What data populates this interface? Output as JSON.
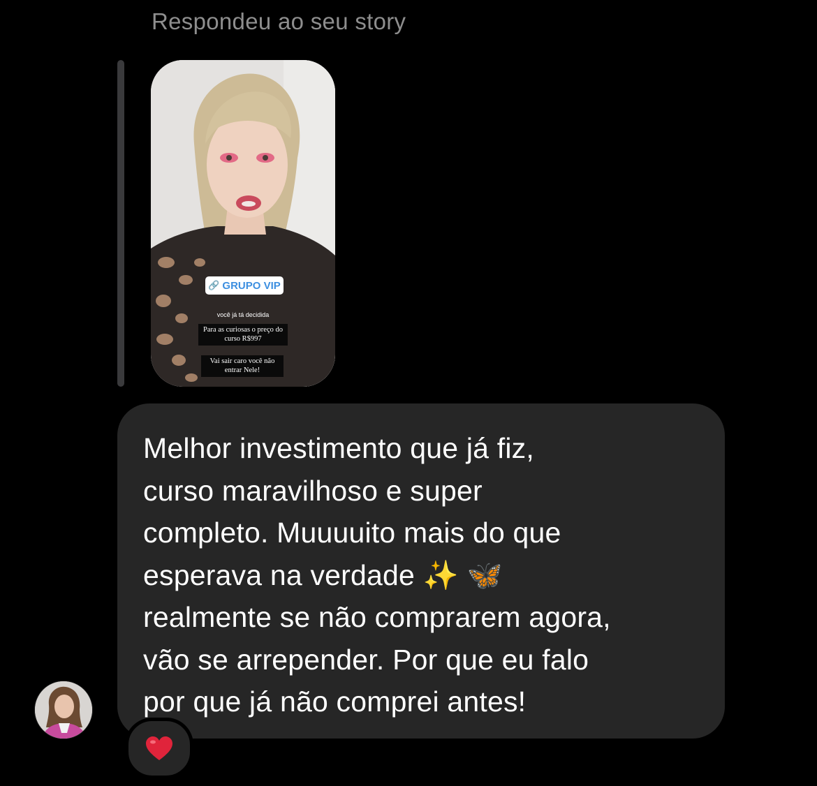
{
  "reply_header": "Respondeu ao seu story",
  "story": {
    "link_sticker": "GRUPO VIP",
    "link_icon": "link-icon",
    "caption_small": "você já tá decidida",
    "caption_box_1": "Para as curiosas o preço do curso R$997",
    "caption_box_2": "Vai sair caro você não entrar Nele!"
  },
  "message": {
    "text": "Melhor investimento que já fiz,\ncurso maravilhoso e super\ncompleto. Muuuuito mais do que\nesperava na verdade ✨ 🦋\nrealmente se não comprarem agora,\nvão se arrepender. Por que eu falo\npor que já não comprei antes!"
  },
  "reaction": {
    "icon": "heart-icon",
    "color": "#e0243b"
  },
  "colors": {
    "background": "#000000",
    "bubble": "#262626",
    "header_text": "#8e8e8e",
    "reply_bar": "#3a3a3c",
    "link_blue": "#3d8fe0"
  }
}
